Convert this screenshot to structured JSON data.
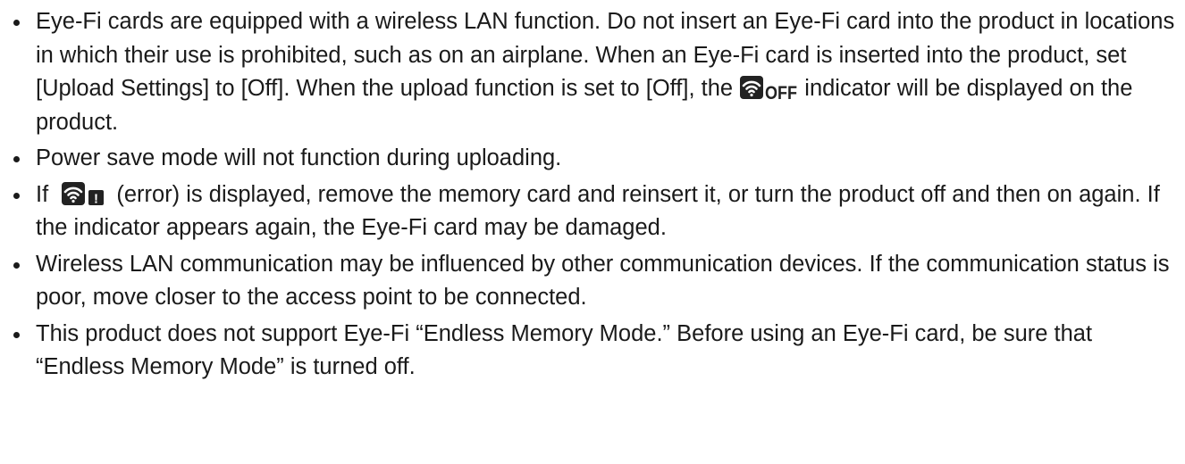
{
  "notes": [
    {
      "before": "Eye-Fi cards are equipped with a wireless LAN function. Do not insert an Eye-Fi card into the product in locations in which their use is prohibited, such as on an airplane. When an Eye-Fi card is inserted into the product, set [Upload Settings] to [Off]. When the upload function is set to [Off], the ",
      "icon": "wifi-off-icon",
      "icon_text": "OFF",
      "after": " indicator will be displayed on the product."
    },
    {
      "text": "Power save mode will not function during uploading."
    },
    {
      "before": "If ",
      "icon": "wifi-error-icon",
      "icon_text": "!",
      "after": " (error) is displayed, remove the memory card and reinsert it, or turn the product off and then on again. If the indicator appears again, the Eye-Fi card may be damaged."
    },
    {
      "text": "Wireless LAN communication may be influenced by other communication devices. If the communication status is poor, move closer to the access point to be connected."
    },
    {
      "text": "This product does not support Eye-Fi “Endless Memory Mode.” Before using an Eye-Fi card, be sure that “Endless Memory Mode” is turned off."
    }
  ]
}
